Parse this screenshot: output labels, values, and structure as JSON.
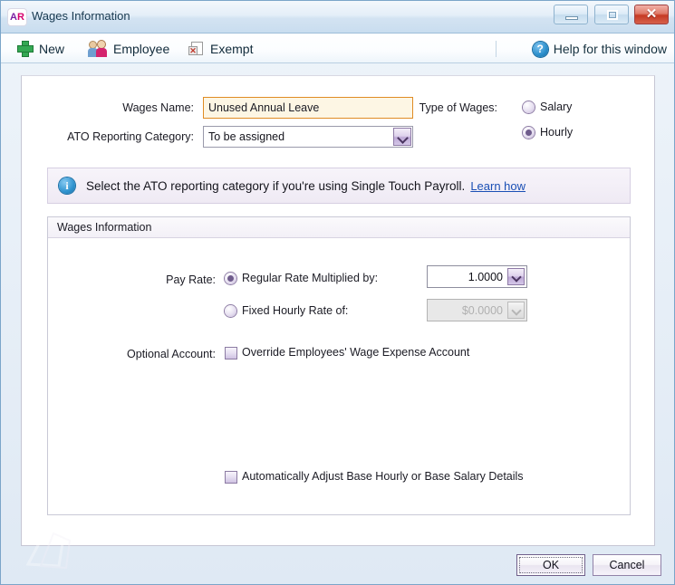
{
  "window": {
    "title": "Wages Information",
    "app_badge": {
      "first": "A",
      "second": "R"
    },
    "buttons": {
      "minimize": "Minimize",
      "maximize": "Maximize",
      "close": "Close"
    }
  },
  "toolbar": {
    "items": [
      {
        "label": "New",
        "icon": "plus-icon"
      },
      {
        "label": "Employee",
        "icon": "employee-icon"
      },
      {
        "label": "Exempt",
        "icon": "exempt-icon"
      }
    ],
    "help": {
      "label": "Help for this window",
      "icon": "help-icon",
      "glyph": "?"
    }
  },
  "form": {
    "wages_name": {
      "label": "Wages Name:",
      "value": "Unused Annual Leave",
      "placeholder": ""
    },
    "ato_category": {
      "label": "ATO Reporting Category:",
      "value": "To be assigned"
    },
    "type_of_wages": {
      "label": "Type of Wages:",
      "options": [
        {
          "label": "Salary",
          "selected": false
        },
        {
          "label": "Hourly",
          "selected": true
        }
      ]
    }
  },
  "banner": {
    "icon": "info-icon",
    "glyph": "i",
    "text": "Select the ATO reporting category if you're using Single Touch Payroll.",
    "link": "Learn how"
  },
  "group": {
    "title": "Wages Information",
    "pay_rate": {
      "label": "Pay Rate:",
      "regular": {
        "label": "Regular Rate Multiplied by:",
        "selected": true,
        "value": "1.0000"
      },
      "fixed": {
        "label": "Fixed Hourly Rate of:",
        "selected": false,
        "value": "$0.0000",
        "disabled": true
      }
    },
    "optional_account": {
      "label": "Optional Account:",
      "checkbox_label": "Override Employees' Wage Expense Account",
      "checked": false
    },
    "auto_adjust": {
      "checkbox_label": "Automatically Adjust Base Hourly or Base Salary Details",
      "checked": false
    }
  },
  "footer": {
    "ok": "OK",
    "cancel": "Cancel"
  },
  "colors": {
    "accent": "#6f5c8c",
    "highlight_border": "#e08c24",
    "highlight_bg": "#fdf6e4",
    "link": "#1a4fb5",
    "close_button": "#c63a24"
  }
}
